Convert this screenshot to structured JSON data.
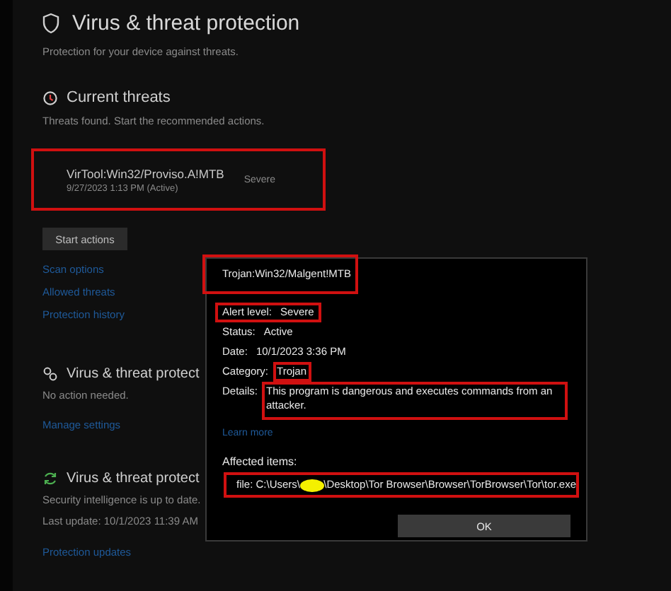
{
  "page": {
    "title": "Virus & threat protection",
    "subtitle": "Protection for your device against threats."
  },
  "current_threats": {
    "heading": "Current threats",
    "description": "Threats found. Start the recommended actions.",
    "threats": [
      {
        "name": "VirTool:Win32/Proviso.A!MTB",
        "date": "9/27/2023 1:13 PM (Active)",
        "severity": "Severe",
        "highlighted": true
      }
    ],
    "button": "Start actions",
    "links": [
      "Scan options",
      "Allowed threats",
      "Protection history"
    ]
  },
  "sections": [
    {
      "kind": "settings",
      "heading": "Virus & threat protect",
      "lines": [
        "No action needed."
      ],
      "link": "Manage settings"
    },
    {
      "kind": "updates",
      "heading": "Virus & threat protect",
      "lines": [
        "Security intelligence is up to date.",
        "Last update: 10/1/2023 11:39 AM"
      ],
      "link": "Protection updates"
    }
  ],
  "dialog": {
    "title": "Trojan:Win32/Malgent!MTB",
    "title_highlighted": true,
    "fields": [
      {
        "label": "Alert level:",
        "value": "Severe",
        "row_highlighted": true,
        "value_highlighted": false
      },
      {
        "label": "Status:",
        "value": "Active",
        "row_highlighted": false,
        "value_highlighted": false
      },
      {
        "label": "Date:",
        "value": "10/1/2023 3:36 PM",
        "row_highlighted": false,
        "value_highlighted": false
      },
      {
        "label": "Category:",
        "value": "Trojan",
        "row_highlighted": false,
        "value_highlighted": true
      },
      {
        "label": "Details:",
        "value": "This program is dangerous and executes commands from an attacker.",
        "row_highlighted": false,
        "value_highlighted": true
      }
    ],
    "link": "Learn more",
    "affected_label": "Affected items:",
    "affected_items": [
      {
        "prefix": "file: C:\\Users\\",
        "suffix": "\\Desktop\\Tor Browser\\Browser\\TorBrowser\\Tor\\tor.exe",
        "redacted": true,
        "highlighted": true
      }
    ],
    "button": "OK"
  }
}
